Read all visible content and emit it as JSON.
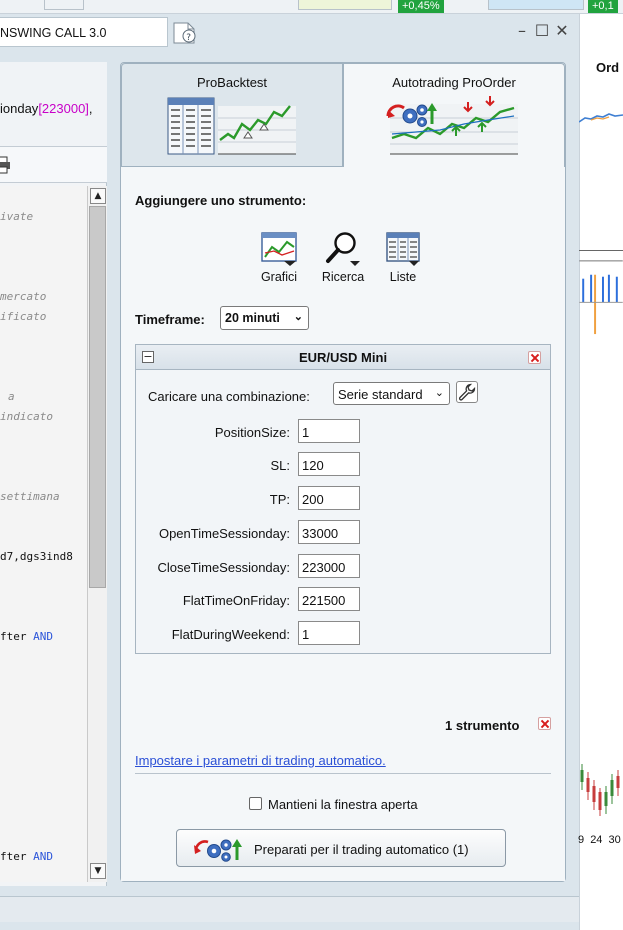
{
  "background": {
    "top_strip": {
      "badge_left": "+0,45%",
      "badge_right": "+0,1"
    },
    "window_title": "NSWING CALL 3.0",
    "editor": {
      "code_call_prefix": "ionday",
      "code_call_number": "[223000]",
      "code_call_suffix": ",",
      "lines": [
        "ivate",
        " mercato",
        "ificato",
        "a",
        "indicato",
        "settimana",
        "d7,dgs3ind8",
        "fter ",
        "fter "
      ],
      "keyword_and": "AND"
    },
    "chart": {
      "header": "Ord",
      "day_labels": [
        "9",
        "24",
        "30"
      ]
    }
  },
  "tabs": [
    {
      "label": "ProBacktest"
    },
    {
      "label": "Autotrading ProOrder"
    }
  ],
  "add_instrument": {
    "label": "Aggiungere uno strumento:",
    "tools": [
      {
        "label": "Grafici",
        "icon": "chart-icon"
      },
      {
        "label": "Ricerca",
        "icon": "magnifier-icon"
      },
      {
        "label": "Liste",
        "icon": "list-icon"
      }
    ]
  },
  "timeframe": {
    "label": "Timeframe:",
    "value": "20 minuti"
  },
  "instrument": {
    "name": "EUR/USD Mini",
    "combination_label": "Caricare una combinazione:",
    "combination_value": "Serie standard",
    "params": [
      {
        "label": "PositionSize:",
        "value": "1"
      },
      {
        "label": "SL:",
        "value": "120"
      },
      {
        "label": "TP:",
        "value": "200"
      },
      {
        "label": "OpenTimeSessionday:",
        "value": "33000"
      },
      {
        "label": "CloseTimeSessionday:",
        "value": "223000"
      },
      {
        "label": "FlatTimeOnFriday:",
        "value": "221500"
      },
      {
        "label": "FlatDuringWeekend:",
        "value": "1"
      }
    ]
  },
  "instrument_count": "1 strumento",
  "settings_link": "Impostare i parametri di trading automatico.",
  "keep_open_label": "Mantieni la finestra aperta",
  "keep_open_checked": false,
  "prepare_button": "Preparati per il trading automatico (1)",
  "colors": {
    "accent_green": "#21a33e",
    "link_blue": "#2a4fd6",
    "remove_red": "#d81e1e",
    "keyword_blue": "#2c55d9",
    "number_magenta": "#c800c8"
  }
}
